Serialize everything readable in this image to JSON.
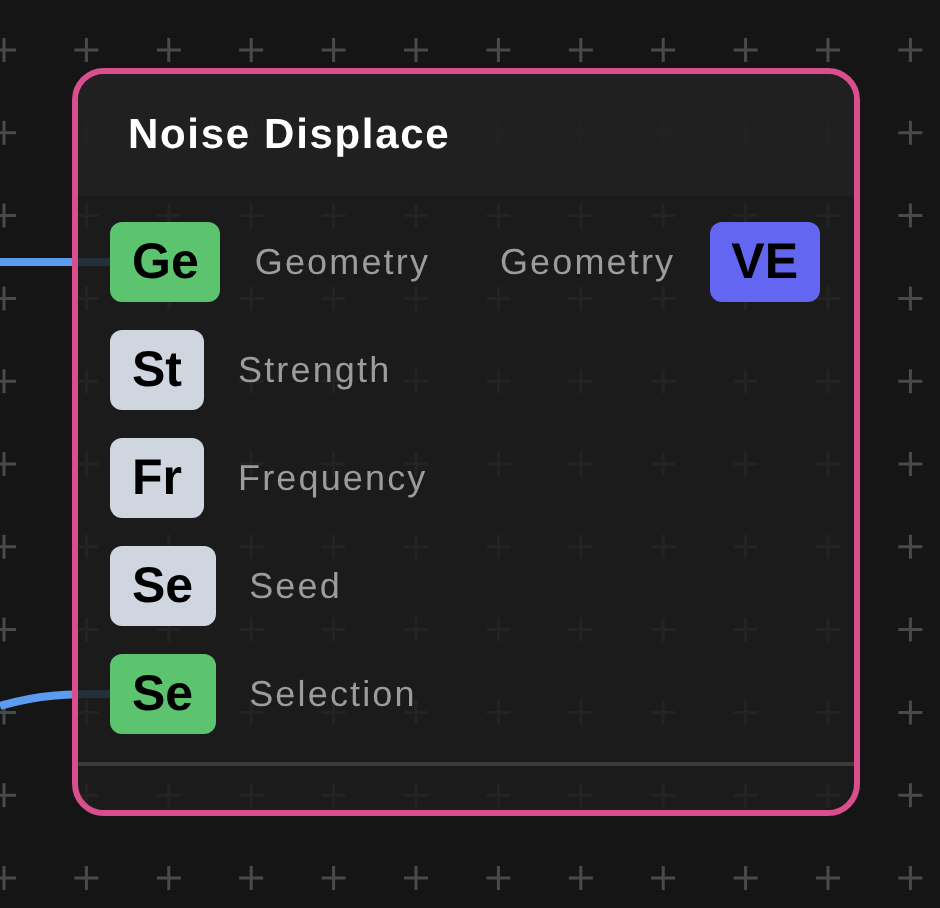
{
  "node": {
    "title": "Noise Displace",
    "inputs": [
      {
        "badge": "Ge",
        "label": "Geometry",
        "kind": "geometry",
        "connected": true
      },
      {
        "badge": "St",
        "label": "Strength",
        "kind": "value",
        "connected": false
      },
      {
        "badge": "Fr",
        "label": "Frequency",
        "kind": "value",
        "connected": false
      },
      {
        "badge": "Se",
        "label": "Seed",
        "kind": "value",
        "connected": false
      },
      {
        "badge": "Se",
        "label": "Selection",
        "kind": "geometry",
        "connected": true
      }
    ],
    "outputs": [
      {
        "badge": "VE",
        "label": "Geometry",
        "kind": "vector"
      }
    ]
  }
}
